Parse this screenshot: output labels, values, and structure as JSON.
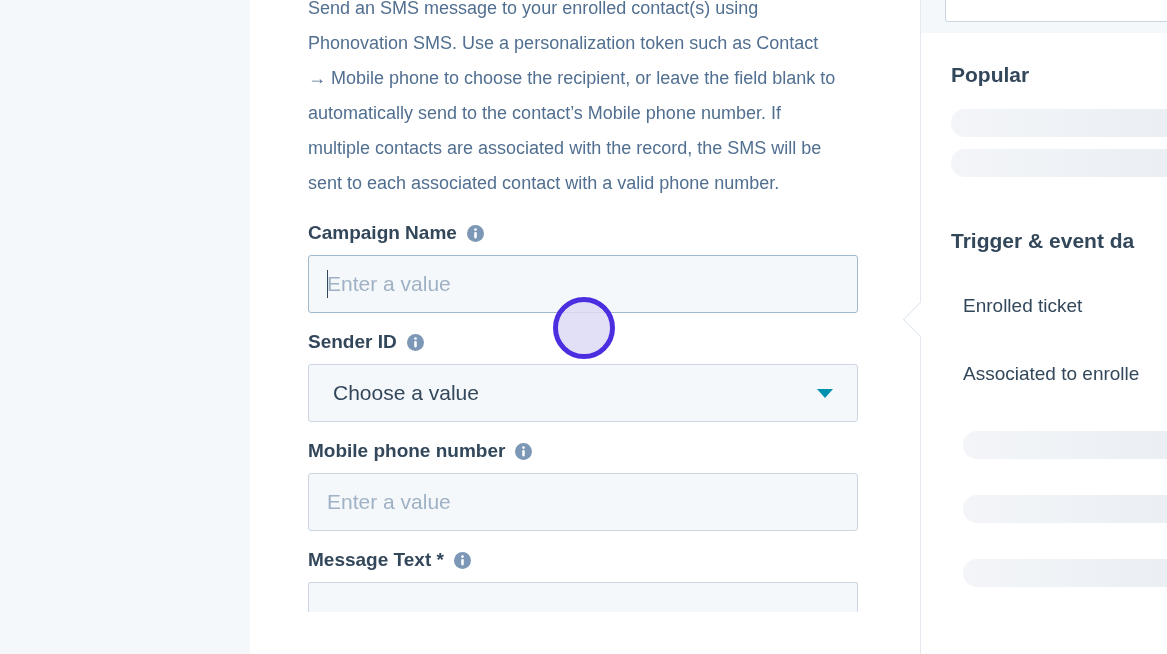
{
  "description": "Send an SMS message to your enrolled contact(s) using Phonovation SMS. Use a personalization token such as Contact → Mobile phone to choose the recipient, or leave the field blank to automatically send to the contact’s Mobile phone number. If multiple contacts are associated with the record, the SMS will be sent to each associated contact with a valid phone number.",
  "fields": [
    {
      "kind": "input",
      "label": "Campaign Name",
      "placeholder": "Enter a value",
      "focused": true
    },
    {
      "kind": "select",
      "label": "Sender ID",
      "value": "Choose a value"
    },
    {
      "kind": "input",
      "label": "Mobile phone number",
      "placeholder": "Enter a value",
      "focused": false
    },
    {
      "kind": "input",
      "label": "Message Text *",
      "focused": false
    }
  ],
  "data_panel": {
    "sections": [
      {
        "title": "Popular",
        "items": [
          {
            "kind": "loading"
          },
          {
            "kind": "loading"
          }
        ]
      },
      {
        "title": "Trigger & event da",
        "items": [
          {
            "kind": "option",
            "label": "Enrolled ticket"
          },
          {
            "kind": "option",
            "label": "Associated to enrolle"
          },
          {
            "kind": "loading"
          },
          {
            "kind": "loading"
          },
          {
            "kind": "loading"
          }
        ]
      }
    ]
  }
}
